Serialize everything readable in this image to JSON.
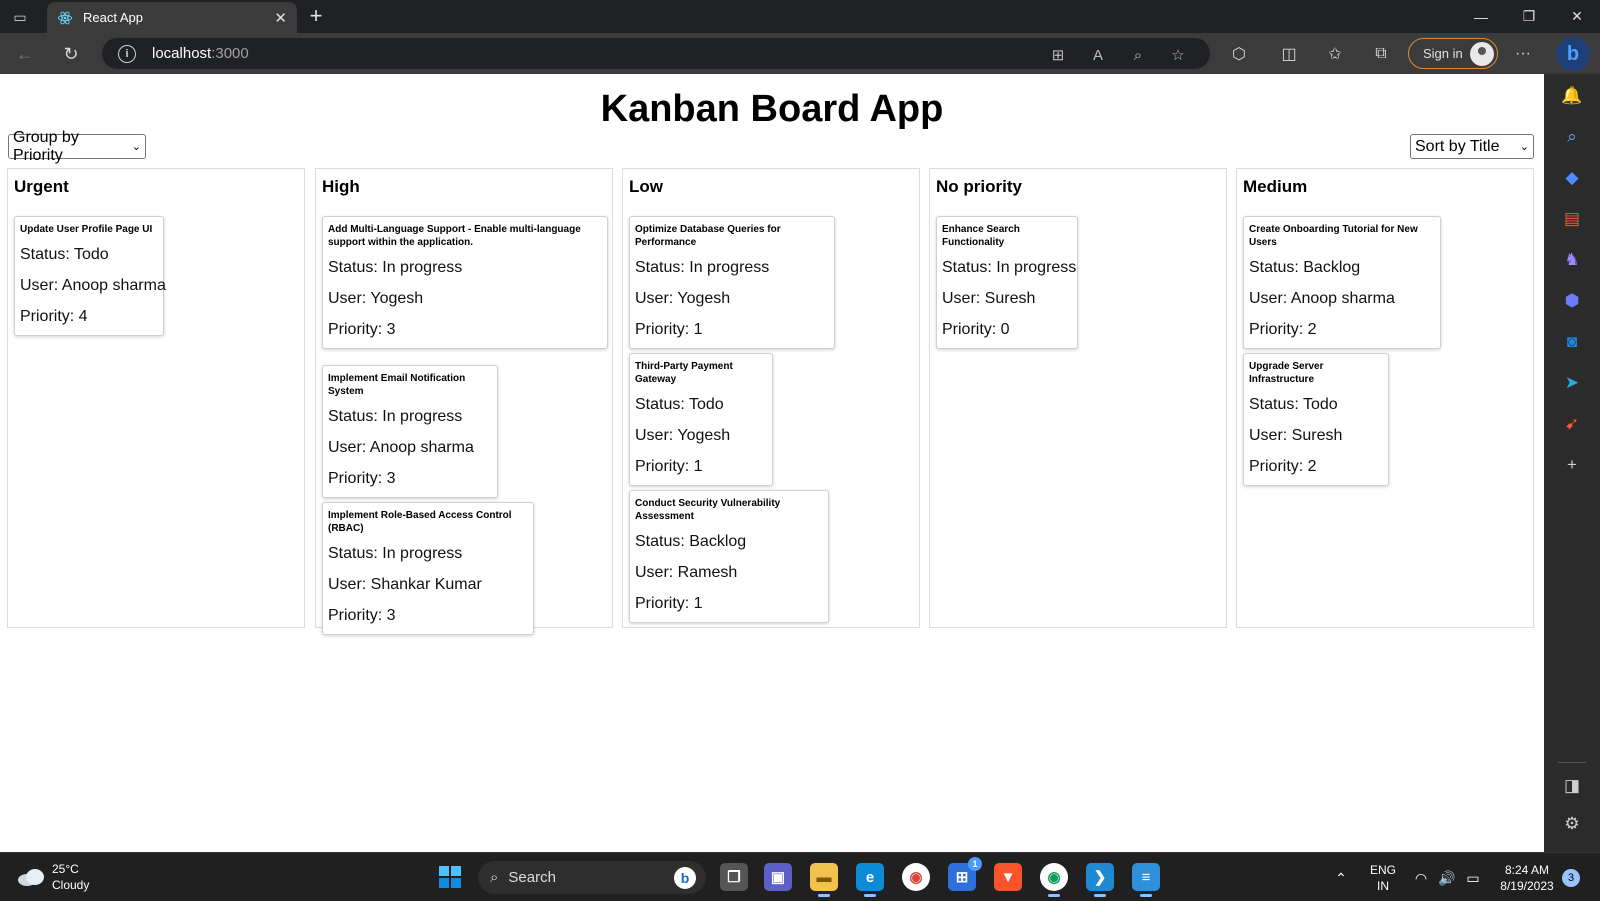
{
  "browser": {
    "tab_title": "React App",
    "tab_close_glyph": "✕",
    "new_tab_glyph": "+",
    "url_host": "localhost",
    "url_port": ":3000",
    "sign_in_label": "Sign in",
    "bing_glyph": "b",
    "accent": "#d88a3a"
  },
  "page": {
    "title": "Kanban Board App",
    "group_select": "Group by Priority",
    "sort_select": "Sort by Title"
  },
  "columns": [
    {
      "title": "Urgent",
      "cards": [
        {
          "title": "Update User Profile Page UI",
          "status": "Status: Todo",
          "user": "User: Anoop sharma",
          "priority": "Priority: 4"
        }
      ]
    },
    {
      "title": "High",
      "cards": [
        {
          "title": "Add Multi-Language Support - Enable multi-language support within the application.",
          "status": "Status: In progress",
          "user": "User: Yogesh",
          "priority": "Priority: 3"
        },
        {
          "title": "Implement Email Notification System",
          "status": "Status: In progress",
          "user": "User: Anoop sharma",
          "priority": "Priority: 3"
        },
        {
          "title": "Implement Role-Based Access Control (RBAC)",
          "status": "Status: In progress",
          "user": "User: Shankar Kumar",
          "priority": "Priority: 3"
        }
      ]
    },
    {
      "title": "Low",
      "cards": [
        {
          "title": "Optimize Database Queries for Performance",
          "status": "Status: In progress",
          "user": "User: Yogesh",
          "priority": "Priority: 1"
        },
        {
          "title": "Third-Party Payment Gateway",
          "status": "Status: Todo",
          "user": "User: Yogesh",
          "priority": "Priority: 1"
        },
        {
          "title": "Conduct Security Vulnerability Assessment",
          "status": "Status: Backlog",
          "user": "User: Ramesh",
          "priority": "Priority: 1"
        }
      ]
    },
    {
      "title": "No priority",
      "cards": [
        {
          "title": "Enhance Search Functionality",
          "status": "Status: In progress",
          "user": "User: Suresh",
          "priority": "Priority: 0"
        }
      ]
    },
    {
      "title": "Medium",
      "cards": [
        {
          "title": "Create Onboarding Tutorial for New Users",
          "status": "Status: Backlog",
          "user": "User: Anoop sharma",
          "priority": "Priority: 2"
        },
        {
          "title": "Upgrade Server Infrastructure",
          "status": "Status: Todo",
          "user": "User: Suresh",
          "priority": "Priority: 2"
        }
      ]
    }
  ],
  "taskbar": {
    "temperature": "25°C",
    "weather": "Cloudy",
    "search_label": "Search",
    "language_top": "ENG",
    "language_bottom": "IN",
    "time": "8:24 AM",
    "date": "8/19/2023",
    "notification_count": "3",
    "store_badge": "1"
  },
  "icons": {
    "sidebar": [
      "bell-icon",
      "search-icon",
      "tag-icon",
      "briefcase-icon",
      "chess-icon",
      "copilot-icon",
      "outlook-icon",
      "telegram-icon",
      "send-icon",
      "add-icon",
      "split-panel-icon",
      "settings-icon"
    ],
    "taskbar": [
      "windows-start-icon",
      "task-view-icon",
      "teams-chat-icon",
      "file-explorer-icon",
      "edge-icon",
      "chrome-icon",
      "store-icon",
      "brave-icon",
      "chrome-profile-icon",
      "vscode-icon",
      "notepad-icon"
    ]
  }
}
